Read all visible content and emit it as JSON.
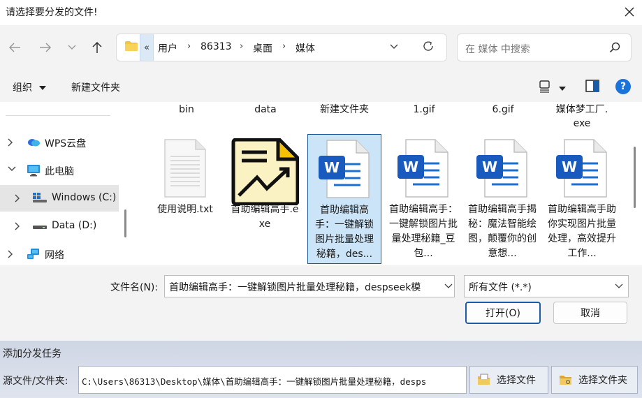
{
  "dialog": {
    "title": "请选择要分发的文件!",
    "address": {
      "overflow": "«",
      "crumbs": [
        "用户",
        "86313",
        "桌面",
        "媒体"
      ],
      "separator": "›"
    },
    "search_placeholder": "在 媒体 中搜索",
    "toolbar": {
      "organize": "组织",
      "new_folder": "新建文件夹"
    },
    "sidebar": {
      "items": [
        {
          "label": "WPS云盘",
          "icon": "cloud-icon",
          "expanded": false
        },
        {
          "label": "此电脑",
          "icon": "pc-icon",
          "expanded": true
        },
        {
          "label": "Windows (C:)",
          "icon": "windows-drive-icon",
          "selected": true
        },
        {
          "label": "Data (D:)",
          "icon": "drive-icon"
        },
        {
          "label": "网络",
          "icon": "network-icon"
        }
      ]
    },
    "files_partial": [
      "bin",
      "data",
      "新建文件夹",
      "1.gif",
      "6.gif",
      "媒体梦工厂.\nexe"
    ],
    "files": [
      {
        "label": "使用说明.txt",
        "icon": "text-file-icon"
      },
      {
        "label": "首助编辑高手.exe",
        "icon": "app-icon"
      },
      {
        "label": "首助编辑高手：一键解锁图片批量处理秘籍，des...",
        "icon": "word-doc-icon",
        "selected": true
      },
      {
        "label": "首助编辑高手：一键解锁图片批量处理秘籍_豆包...",
        "icon": "word-doc-icon"
      },
      {
        "label": "首助编辑高手揭秘：魔法智能绘图，颠覆你的创意想...",
        "icon": "word-doc-icon"
      },
      {
        "label": "首助编辑高手助你实现图片批量处理，高效提升工作...",
        "icon": "word-doc-icon"
      }
    ],
    "filename_label": "文件名(N):",
    "filename_value": "首助编辑高手：一键解锁图片批量处理秘籍，despseek模",
    "filetype_value": "所有文件 (*.*)",
    "open_label": "打开(O)",
    "cancel_label": "取消"
  },
  "background_app": {
    "task_title": "添加分发任务",
    "source_label": "源文件/文件夹:",
    "source_value": "C:\\Users\\86313\\Desktop\\媒体\\首助编辑高手：一键解锁图片批量处理秘籍，desps",
    "select_file": "选择文件",
    "select_folder": "选择文件夹"
  },
  "colors": {
    "accent": "#1a73d9",
    "selection": "#cce4f7",
    "word_blue": "#185abd",
    "folder": "#f4c542"
  }
}
